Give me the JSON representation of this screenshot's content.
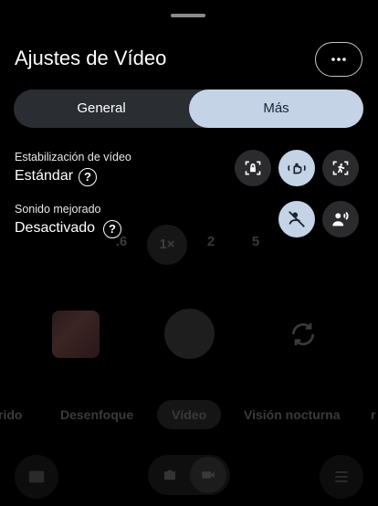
{
  "sheet": {
    "title": "Ajustes de Vídeo",
    "more_icon": "more-horiz-icon",
    "tabs": [
      {
        "label": "General",
        "selected": false
      },
      {
        "label": "Más",
        "selected": true
      }
    ],
    "settings": [
      {
        "label": "Estabilización de vídeo",
        "value": "Estándar",
        "options": [
          "lock-frame-icon",
          "hand-stabilize-icon",
          "active-motion-icon"
        ],
        "selected_option": 1
      },
      {
        "label": "Sonido mejorado",
        "value": "Desactivado",
        "options": [
          "mic-off-icon",
          "speech-enhance-icon"
        ],
        "selected_option": 0
      }
    ],
    "help_glyph": "?"
  },
  "camera": {
    "zoom": [
      ".6",
      "1×",
      "2",
      "5"
    ],
    "zoom_selected": 1,
    "modes": [
      "rido",
      "Desenfoque",
      "Vídeo",
      "Visión nocturna",
      "r"
    ],
    "mode_selected": 2
  },
  "colors": {
    "accent": "#c4d4e6",
    "tab_track": "#2a2d31",
    "option_bg": "#2b2b2d"
  }
}
